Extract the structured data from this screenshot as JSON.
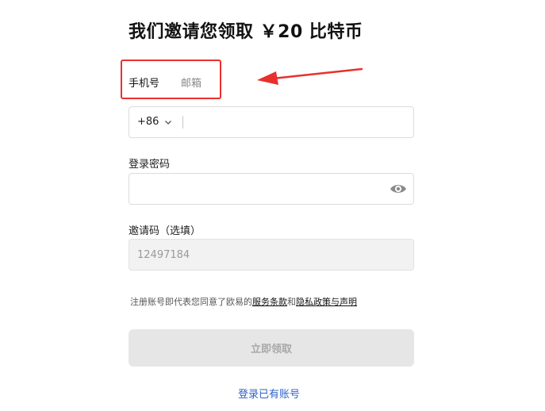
{
  "header": {
    "title": "我们邀请您领取 ￥20 比特币"
  },
  "tabs": [
    {
      "label": "手机号",
      "active": true
    },
    {
      "label": "邮箱",
      "active": false
    }
  ],
  "phone": {
    "country_code": "+86",
    "value": ""
  },
  "password": {
    "label": "登录密码",
    "value": ""
  },
  "invite": {
    "label": "邀请码（选填）",
    "value": "12497184"
  },
  "terms": {
    "prefix": "注册账号即代表您同意了欧易的",
    "link1": "服务条款",
    "mid": "和",
    "link2": "隐私政策与声明"
  },
  "submit_label": "立即领取",
  "login_link": "登录已有账号",
  "colors": {
    "annotation": "#e8312c",
    "tab_underline": "#7a2be2",
    "link": "#2e62c9"
  },
  "icons": [
    "chevron-down-icon",
    "eye-icon",
    "red-arrow-annotation"
  ]
}
